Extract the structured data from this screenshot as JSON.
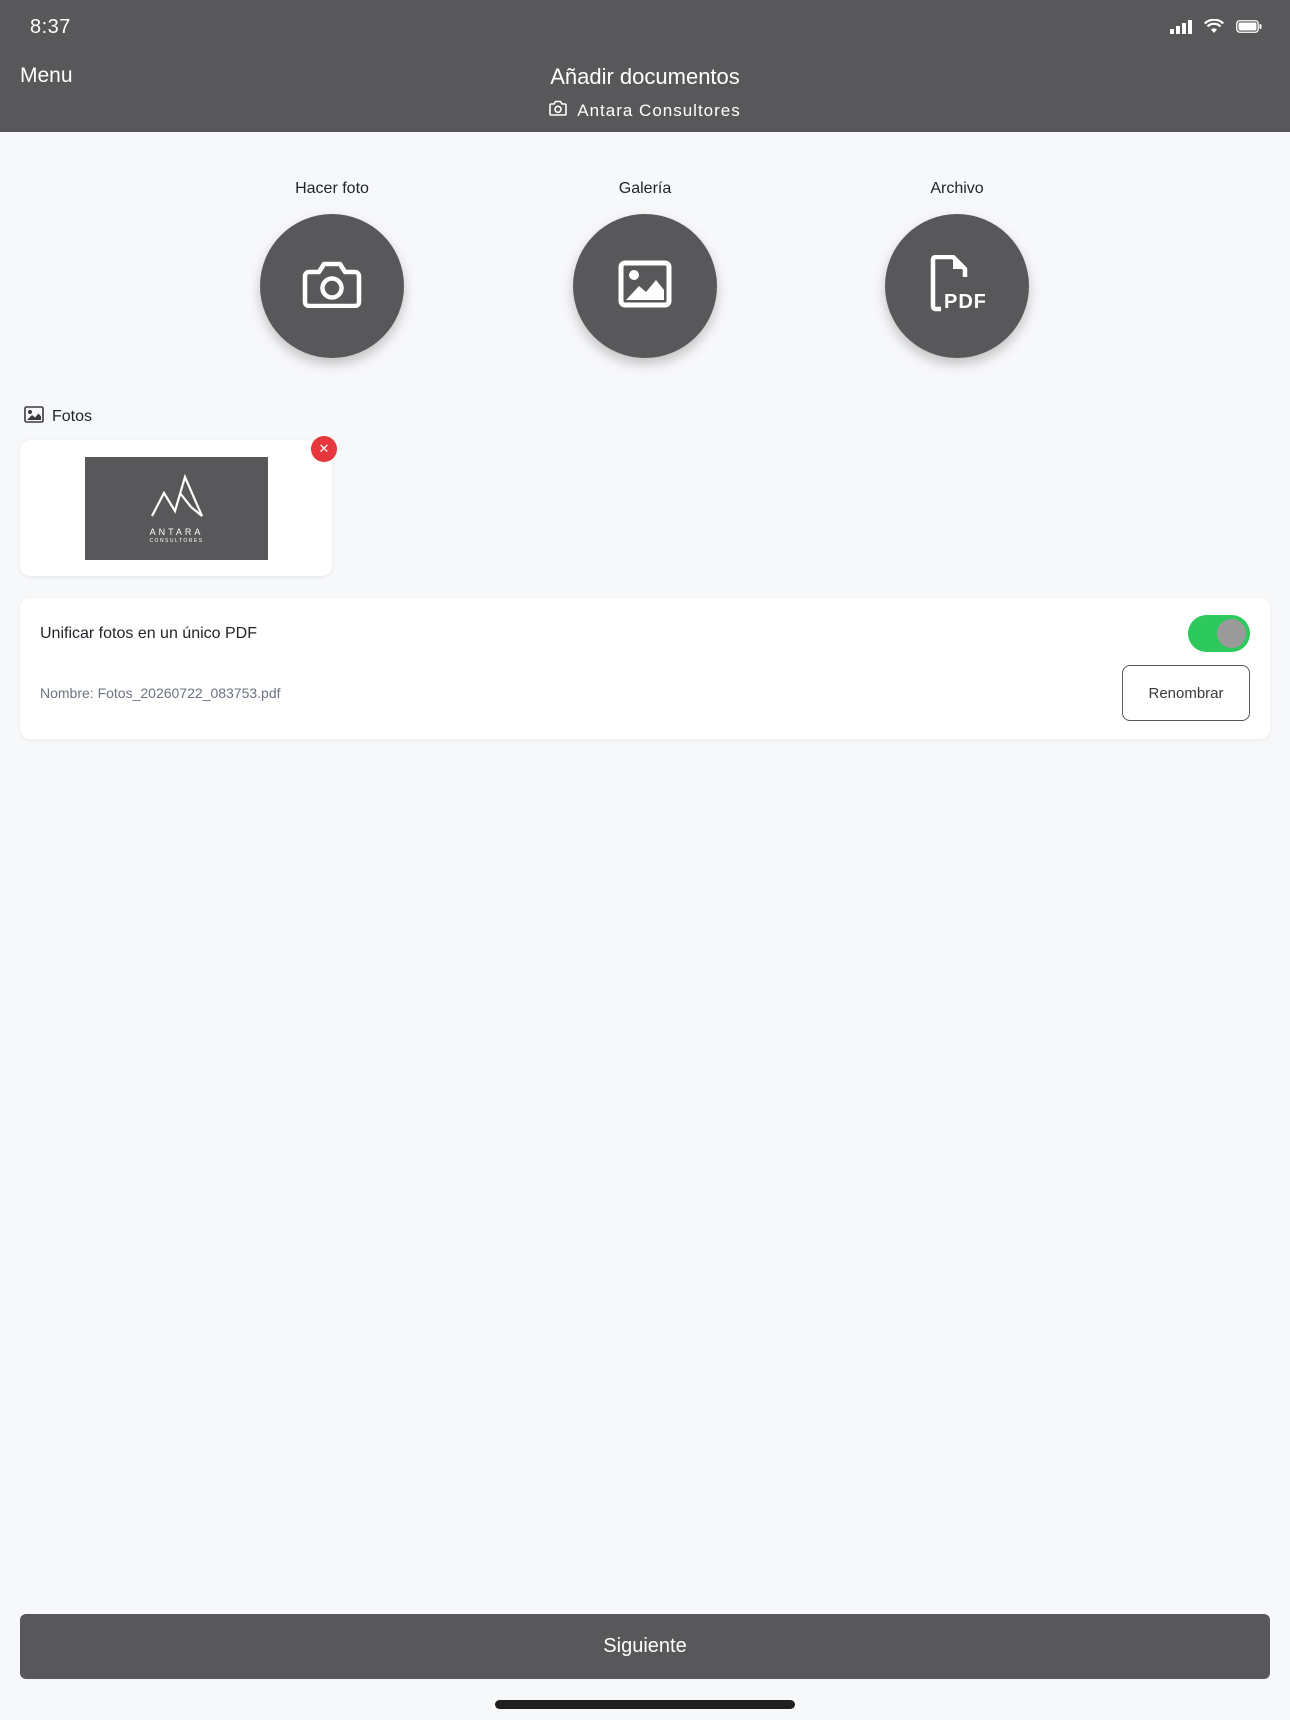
{
  "status_bar": {
    "time": "8:37"
  },
  "header": {
    "menu_label": "Menu",
    "title": "Añadir documentos",
    "subtitle": "Antara Consultores"
  },
  "actions": [
    {
      "label": "Hacer foto",
      "icon": "camera-icon"
    },
    {
      "label": "Galería",
      "icon": "image-icon"
    },
    {
      "label": "Archivo",
      "icon": "pdf-file-icon"
    }
  ],
  "fotos": {
    "section_label": "Fotos",
    "thumbnail_brand": "ANTARA",
    "thumbnail_brand_sub": "CONSULTORES"
  },
  "merge": {
    "label": "Unificar fotos en un único PDF",
    "enabled": true,
    "file_name": "Nombre: Fotos_20260722_083753.pdf",
    "rename_label": "Renombrar"
  },
  "footer": {
    "next_label": "Siguiente"
  },
  "colors": {
    "header_bg": "#58585a",
    "toggle_on": "#2ec95c",
    "remove_red": "#e5373c",
    "background": "#f7f8fa"
  }
}
